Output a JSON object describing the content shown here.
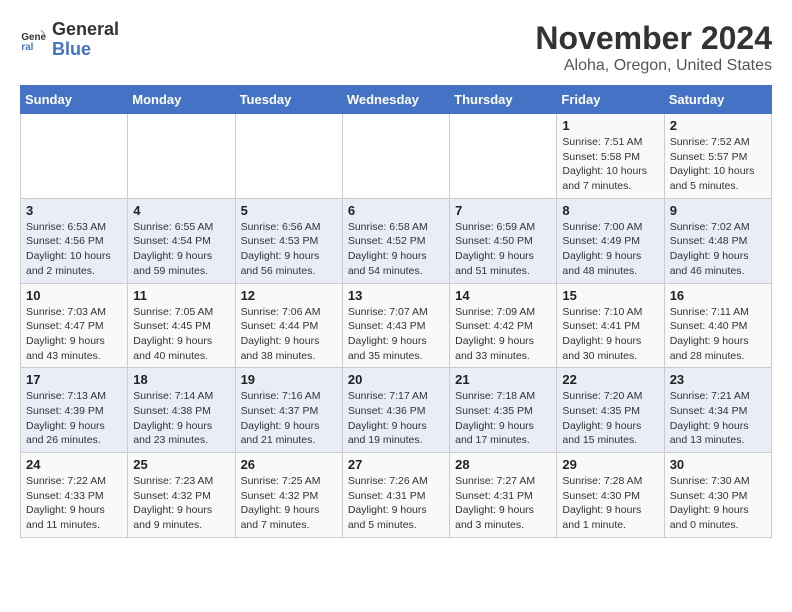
{
  "logo": {
    "line1": "General",
    "line2": "Blue"
  },
  "title": "November 2024",
  "subtitle": "Aloha, Oregon, United States",
  "weekdays": [
    "Sunday",
    "Monday",
    "Tuesday",
    "Wednesday",
    "Thursday",
    "Friday",
    "Saturday"
  ],
  "weeks": [
    [
      {
        "day": "",
        "detail": ""
      },
      {
        "day": "",
        "detail": ""
      },
      {
        "day": "",
        "detail": ""
      },
      {
        "day": "",
        "detail": ""
      },
      {
        "day": "",
        "detail": ""
      },
      {
        "day": "1",
        "detail": "Sunrise: 7:51 AM\nSunset: 5:58 PM\nDaylight: 10 hours and 7 minutes."
      },
      {
        "day": "2",
        "detail": "Sunrise: 7:52 AM\nSunset: 5:57 PM\nDaylight: 10 hours and 5 minutes."
      }
    ],
    [
      {
        "day": "3",
        "detail": "Sunrise: 6:53 AM\nSunset: 4:56 PM\nDaylight: 10 hours and 2 minutes."
      },
      {
        "day": "4",
        "detail": "Sunrise: 6:55 AM\nSunset: 4:54 PM\nDaylight: 9 hours and 59 minutes."
      },
      {
        "day": "5",
        "detail": "Sunrise: 6:56 AM\nSunset: 4:53 PM\nDaylight: 9 hours and 56 minutes."
      },
      {
        "day": "6",
        "detail": "Sunrise: 6:58 AM\nSunset: 4:52 PM\nDaylight: 9 hours and 54 minutes."
      },
      {
        "day": "7",
        "detail": "Sunrise: 6:59 AM\nSunset: 4:50 PM\nDaylight: 9 hours and 51 minutes."
      },
      {
        "day": "8",
        "detail": "Sunrise: 7:00 AM\nSunset: 4:49 PM\nDaylight: 9 hours and 48 minutes."
      },
      {
        "day": "9",
        "detail": "Sunrise: 7:02 AM\nSunset: 4:48 PM\nDaylight: 9 hours and 46 minutes."
      }
    ],
    [
      {
        "day": "10",
        "detail": "Sunrise: 7:03 AM\nSunset: 4:47 PM\nDaylight: 9 hours and 43 minutes."
      },
      {
        "day": "11",
        "detail": "Sunrise: 7:05 AM\nSunset: 4:45 PM\nDaylight: 9 hours and 40 minutes."
      },
      {
        "day": "12",
        "detail": "Sunrise: 7:06 AM\nSunset: 4:44 PM\nDaylight: 9 hours and 38 minutes."
      },
      {
        "day": "13",
        "detail": "Sunrise: 7:07 AM\nSunset: 4:43 PM\nDaylight: 9 hours and 35 minutes."
      },
      {
        "day": "14",
        "detail": "Sunrise: 7:09 AM\nSunset: 4:42 PM\nDaylight: 9 hours and 33 minutes."
      },
      {
        "day": "15",
        "detail": "Sunrise: 7:10 AM\nSunset: 4:41 PM\nDaylight: 9 hours and 30 minutes."
      },
      {
        "day": "16",
        "detail": "Sunrise: 7:11 AM\nSunset: 4:40 PM\nDaylight: 9 hours and 28 minutes."
      }
    ],
    [
      {
        "day": "17",
        "detail": "Sunrise: 7:13 AM\nSunset: 4:39 PM\nDaylight: 9 hours and 26 minutes."
      },
      {
        "day": "18",
        "detail": "Sunrise: 7:14 AM\nSunset: 4:38 PM\nDaylight: 9 hours and 23 minutes."
      },
      {
        "day": "19",
        "detail": "Sunrise: 7:16 AM\nSunset: 4:37 PM\nDaylight: 9 hours and 21 minutes."
      },
      {
        "day": "20",
        "detail": "Sunrise: 7:17 AM\nSunset: 4:36 PM\nDaylight: 9 hours and 19 minutes."
      },
      {
        "day": "21",
        "detail": "Sunrise: 7:18 AM\nSunset: 4:35 PM\nDaylight: 9 hours and 17 minutes."
      },
      {
        "day": "22",
        "detail": "Sunrise: 7:20 AM\nSunset: 4:35 PM\nDaylight: 9 hours and 15 minutes."
      },
      {
        "day": "23",
        "detail": "Sunrise: 7:21 AM\nSunset: 4:34 PM\nDaylight: 9 hours and 13 minutes."
      }
    ],
    [
      {
        "day": "24",
        "detail": "Sunrise: 7:22 AM\nSunset: 4:33 PM\nDaylight: 9 hours and 11 minutes."
      },
      {
        "day": "25",
        "detail": "Sunrise: 7:23 AM\nSunset: 4:32 PM\nDaylight: 9 hours and 9 minutes."
      },
      {
        "day": "26",
        "detail": "Sunrise: 7:25 AM\nSunset: 4:32 PM\nDaylight: 9 hours and 7 minutes."
      },
      {
        "day": "27",
        "detail": "Sunrise: 7:26 AM\nSunset: 4:31 PM\nDaylight: 9 hours and 5 minutes."
      },
      {
        "day": "28",
        "detail": "Sunrise: 7:27 AM\nSunset: 4:31 PM\nDaylight: 9 hours and 3 minutes."
      },
      {
        "day": "29",
        "detail": "Sunrise: 7:28 AM\nSunset: 4:30 PM\nDaylight: 9 hours and 1 minute."
      },
      {
        "day": "30",
        "detail": "Sunrise: 7:30 AM\nSunset: 4:30 PM\nDaylight: 9 hours and 0 minutes."
      }
    ]
  ]
}
